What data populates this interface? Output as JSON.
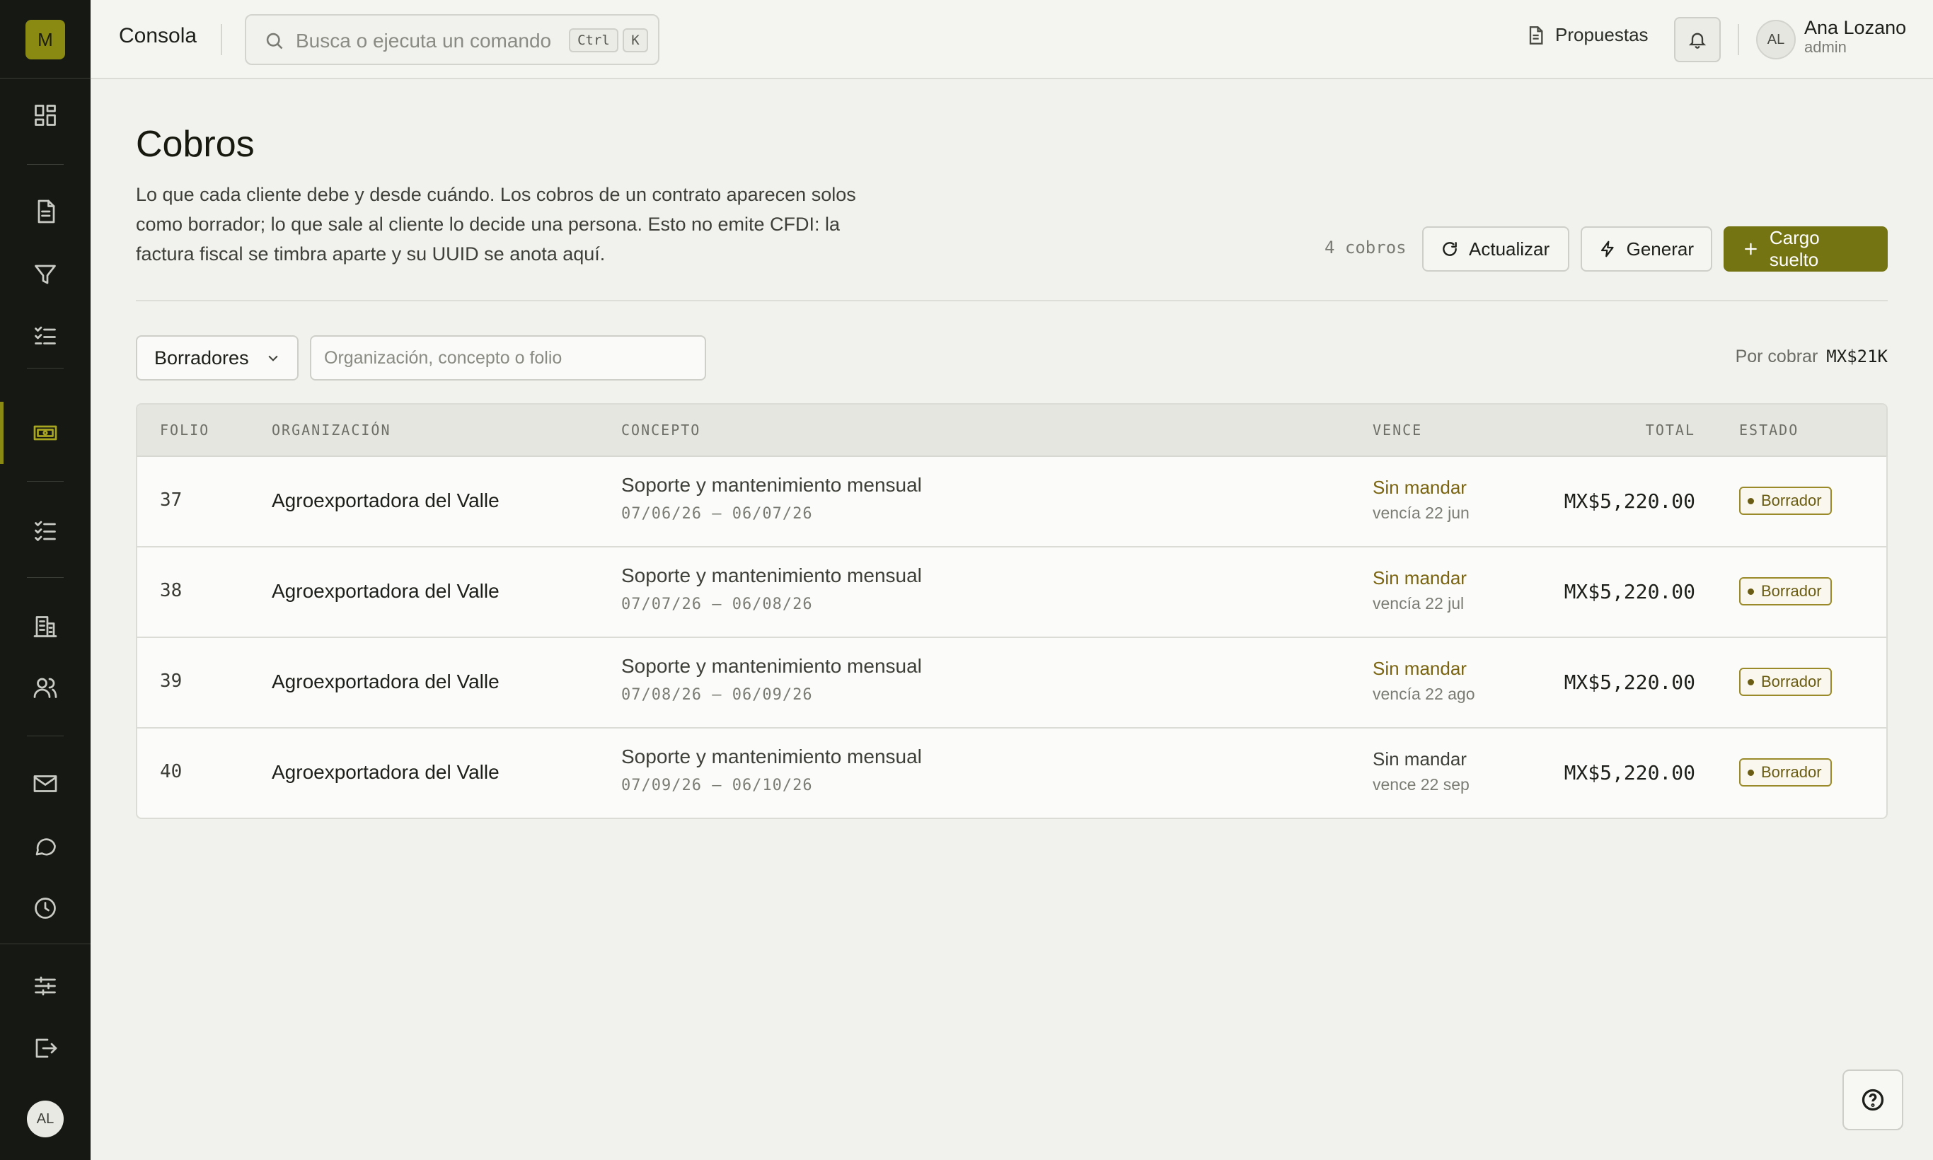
{
  "sidebar": {
    "logo": "M",
    "avatar": "AL",
    "items": [
      {
        "icon": "dashboard-icon"
      },
      {
        "icon": "document-icon"
      },
      {
        "icon": "funnel-icon"
      },
      {
        "icon": "checklist-icon"
      },
      {
        "icon": "billing-icon",
        "active": true
      },
      {
        "icon": "tasks-icon"
      },
      {
        "icon": "building-icon"
      },
      {
        "icon": "users-icon"
      },
      {
        "icon": "mail-icon"
      },
      {
        "icon": "chat-icon"
      },
      {
        "icon": "clock-icon"
      },
      {
        "icon": "settings-sliders-icon"
      },
      {
        "icon": "logout-icon"
      }
    ]
  },
  "header": {
    "brand": "Consola",
    "search_placeholder": "Busca o ejecuta un comando",
    "kbd_ctrl": "Ctrl",
    "kbd_k": "K",
    "propuestas": "Propuestas",
    "user": {
      "initials": "AL",
      "name": "Ana Lozano",
      "role": "admin"
    }
  },
  "page": {
    "title": "Cobros",
    "description": "Lo que cada cliente debe y desde cuándo. Los cobros de un contrato aparecen solos como borrador; lo que sale al cliente lo decide una persona. Esto no emite CFDI: la factura fiscal se timbra aparte y su UUID se anota aquí.",
    "count": "4 cobros",
    "buttons": {
      "refresh": "Actualizar",
      "generate": "Generar",
      "add": "Cargo suelto"
    }
  },
  "filters": {
    "status_selected": "Borradores",
    "search_placeholder": "Organización, concepto o folio",
    "receivable_label": "Por cobrar",
    "receivable_amount": "MX$21K"
  },
  "table": {
    "columns": {
      "folio": "FOLIO",
      "org": "ORGANIZACIÓN",
      "concept": "CONCEPTO",
      "due": "VENCE",
      "total": "TOTAL",
      "status": "ESTADO"
    },
    "rows": [
      {
        "folio": "37",
        "org": "Agroexportadora del Valle",
        "concept": "Soporte y mantenimiento mensual",
        "period": "07/06/26 – 06/07/26",
        "due": "Sin mandar",
        "due_sub": "vencía 22 jun",
        "overdue": true,
        "total": "MX$5,220.00",
        "status": "Borrador"
      },
      {
        "folio": "38",
        "org": "Agroexportadora del Valle",
        "concept": "Soporte y mantenimiento mensual",
        "period": "07/07/26 – 06/08/26",
        "due": "Sin mandar",
        "due_sub": "vencía 22 jul",
        "overdue": true,
        "total": "MX$5,220.00",
        "status": "Borrador"
      },
      {
        "folio": "39",
        "org": "Agroexportadora del Valle",
        "concept": "Soporte y mantenimiento mensual",
        "period": "07/08/26 – 06/09/26",
        "due": "Sin mandar",
        "due_sub": "vencía 22 ago",
        "overdue": true,
        "total": "MX$5,220.00",
        "status": "Borrador"
      },
      {
        "folio": "40",
        "org": "Agroexportadora del Valle",
        "concept": "Soporte y mantenimiento mensual",
        "period": "07/09/26 – 06/10/26",
        "due": "Sin mandar",
        "due_sub": "vence 22 sep",
        "overdue": false,
        "total": "MX$5,220.00",
        "status": "Borrador"
      }
    ]
  },
  "colors": {
    "accent": "#747412",
    "overdue_text": "#7a6410",
    "normal_text": "#3d3f38",
    "sidebar_bg": "#161814"
  }
}
